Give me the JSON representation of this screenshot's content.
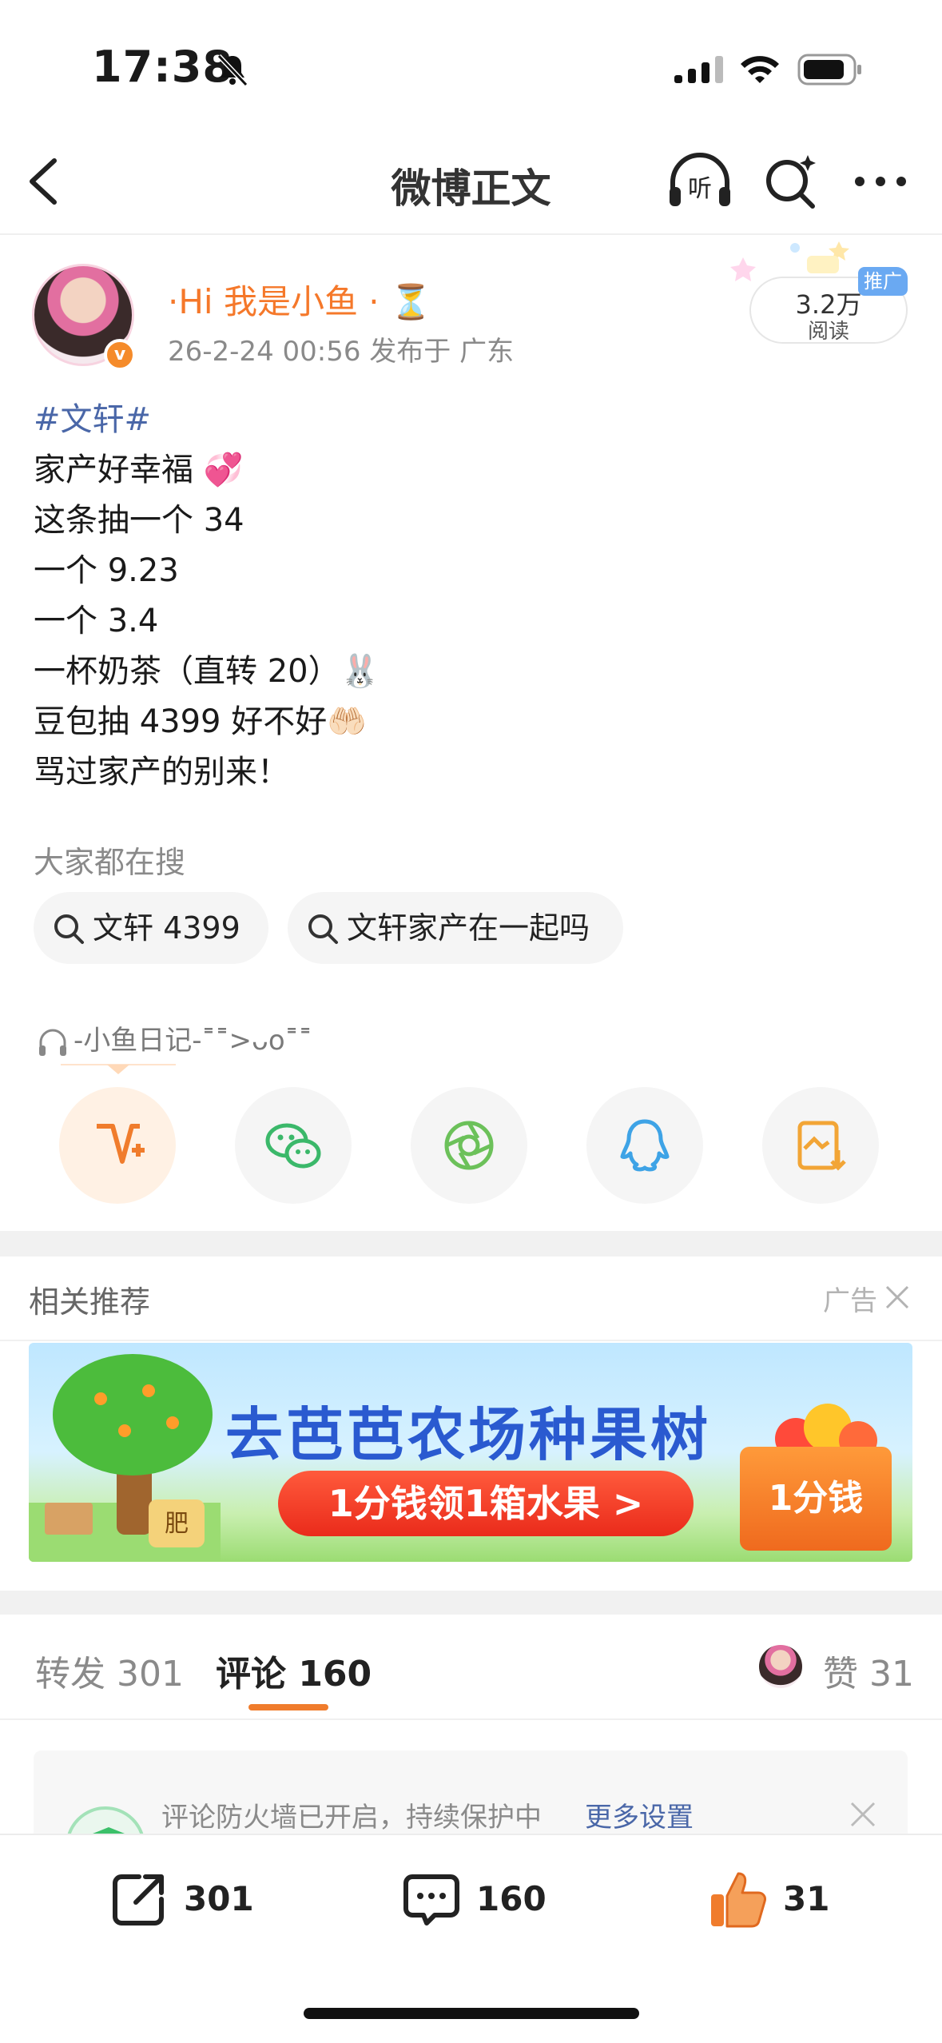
{
  "status_bar": {
    "time": "17:38"
  },
  "nav": {
    "title": "微博正文"
  },
  "author": {
    "name": "·Hi 我是小鱼 · ⏳",
    "meta": "26-2-24 00:56  发布于 广东",
    "reads": "3.2万",
    "reads_label": "阅读",
    "promo_tag": "推广"
  },
  "post": {
    "hashtag": "#文轩#",
    "lines": [
      "家产好幸福 💞",
      "这条抽一个 34",
      "一个 9.23",
      "一个 3.4",
      "一杯奶茶（直转 20）🐰",
      "豆包抽 4399 好不好🤲🏻",
      "骂过家产的别来！"
    ]
  },
  "search": {
    "label": "大家都在搜",
    "chips": [
      "文轩 4399",
      "文轩家产在一起吗"
    ]
  },
  "audio": {
    "label": "-小鱼日记-˭˭>ᴗo˭˭"
  },
  "recommend": {
    "title": "相关推荐",
    "ad_label": "广告",
    "banner_title": "去芭芭农场种果树",
    "banner_button": "1分钱领1箱水果 >",
    "banner_crate": "1分钱",
    "banner_fertilizer": "肥"
  },
  "tabs": {
    "repost": "转发  301",
    "comment": "评论  160",
    "like": "赞  31"
  },
  "firewall": {
    "text": "评论防火墙已开启，持续保护中",
    "link": "更多设置"
  },
  "bottom_bar": {
    "repost": "301",
    "comment": "160",
    "like": "31"
  },
  "colors": {
    "accent": "#f07c2c",
    "author": "#f5782a",
    "link": "#4a67a8"
  }
}
